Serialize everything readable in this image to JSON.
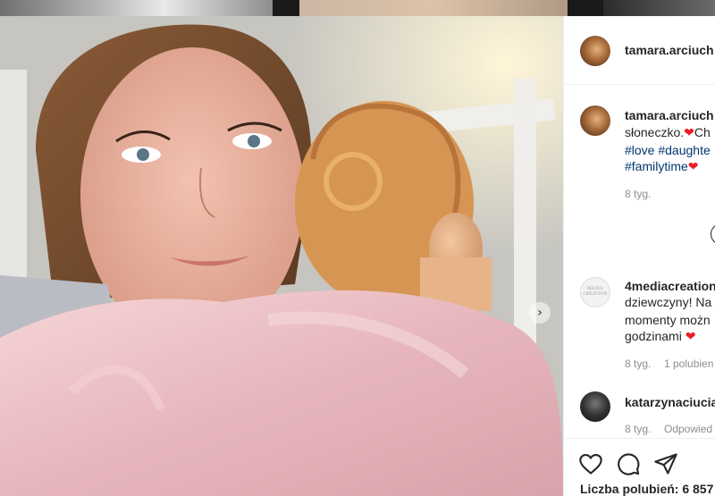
{
  "post": {
    "author": "tamara.arciuch",
    "caption": {
      "author": "tamara.arciuch",
      "line1_text": "słoneczko.",
      "line1_heart": "❤",
      "line1_cont": "Ch",
      "line2_tag1": "#love",
      "line2_tag2": "#daughte",
      "line3_tag": "#familytime",
      "line3_heart": "❤",
      "time": "8 tyg."
    },
    "likes": "Liczba polubień: 6 857"
  },
  "comments": [
    {
      "username": "4mediacreation",
      "avatar_text": "MEDIA CREATION",
      "line1": "dziewczyny! Na",
      "line2": "momenty możn",
      "line3": "godzinami",
      "heart": "❤",
      "time": "8 tyg.",
      "likes": "1 polubien"
    },
    {
      "username": "katarzynaciucia",
      "time": "8 tyg.",
      "reply": "Odpowied"
    }
  ],
  "icons": {
    "next": "chevron-right-icon",
    "like": "heart-icon",
    "comment": "comment-icon",
    "share": "send-icon"
  },
  "colors": {
    "hashtag": "#00376b",
    "heart": "#ed1c24",
    "meta": "#8e8e8e"
  }
}
